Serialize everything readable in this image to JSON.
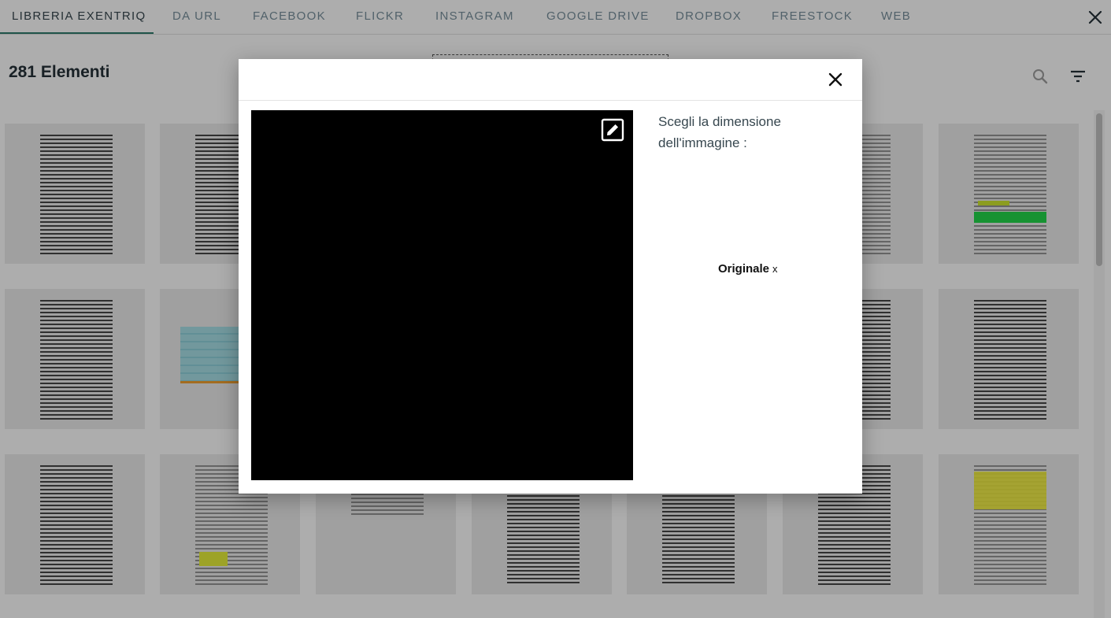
{
  "tabs": [
    {
      "label": "LIBRERIA EXENTRIQ",
      "active": true
    },
    {
      "label": "DA URL"
    },
    {
      "label": "FACEBOOK"
    },
    {
      "label": "FLICKR"
    },
    {
      "label": "INSTAGRAM"
    },
    {
      "label": "GOOGLE DRIVE"
    },
    {
      "label": "DROPBOX"
    },
    {
      "label": "FREESTOCK"
    },
    {
      "label": "WEB"
    }
  ],
  "library": {
    "count_title": "281 Elementi",
    "icons": [
      "search-icon",
      "filter-icon",
      "close-icon"
    ]
  },
  "modal": {
    "heading": "Scegli la dimensione dell'immagine :",
    "size_option_label": "Originale",
    "size_option_separator": "x",
    "icons": [
      "close-icon",
      "edit-icon"
    ]
  },
  "colors": {
    "accent": "#2e7d6e",
    "text_dark": "#263238",
    "tab_text": "#78909c",
    "preview_bg": "#000000"
  }
}
